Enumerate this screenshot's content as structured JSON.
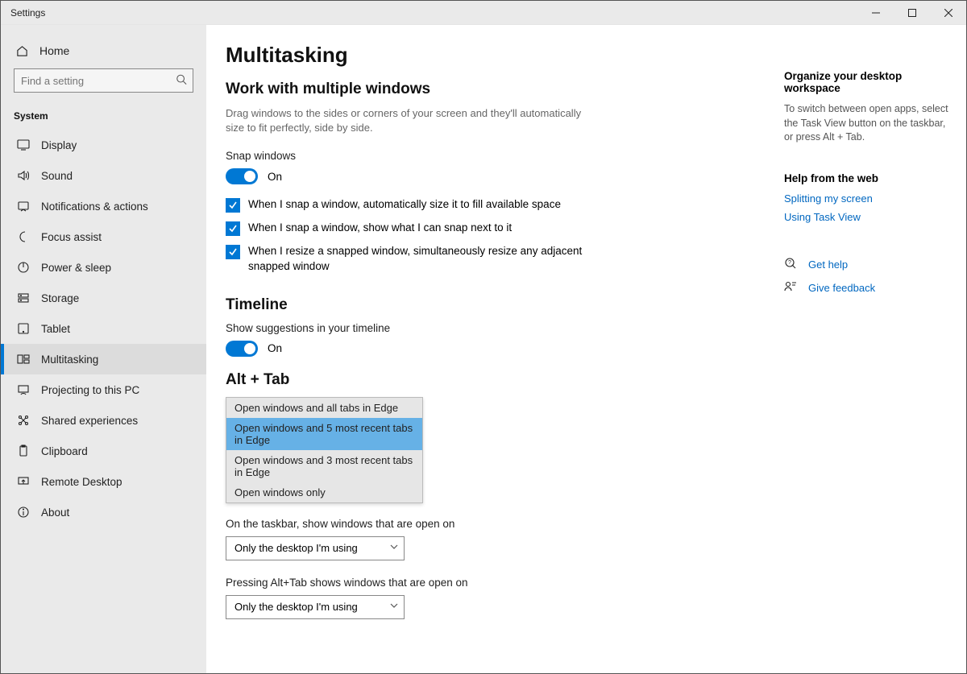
{
  "window": {
    "title": "Settings"
  },
  "sidebar": {
    "home": "Home",
    "search_placeholder": "Find a setting",
    "section": "System",
    "items": [
      {
        "label": "Display"
      },
      {
        "label": "Sound"
      },
      {
        "label": "Notifications & actions"
      },
      {
        "label": "Focus assist"
      },
      {
        "label": "Power & sleep"
      },
      {
        "label": "Storage"
      },
      {
        "label": "Tablet"
      },
      {
        "label": "Multitasking"
      },
      {
        "label": "Projecting to this PC"
      },
      {
        "label": "Shared experiences"
      },
      {
        "label": "Clipboard"
      },
      {
        "label": "Remote Desktop"
      },
      {
        "label": "About"
      }
    ]
  },
  "page": {
    "title": "Multitasking",
    "section1": {
      "heading": "Work with multiple windows",
      "desc": "Drag windows to the sides or corners of your screen and they'll automatically size to fit perfectly, side by side.",
      "snap_label": "Snap windows",
      "snap_state": "On",
      "chk1": "When I snap a window, automatically size it to fill available space",
      "chk2": "When I snap a window, show what I can snap next to it",
      "chk3": "When I resize a snapped window, simultaneously resize any adjacent snapped window"
    },
    "section2": {
      "heading": "Timeline",
      "label": "Show suggestions in your timeline",
      "state": "On"
    },
    "section3": {
      "heading": "Alt + Tab",
      "options": [
        "Open windows and all tabs in Edge",
        "Open windows and 5 most recent tabs in Edge",
        "Open windows and 3 most recent tabs in Edge",
        "Open windows only"
      ]
    },
    "section4": {
      "label1": "On the taskbar, show windows that are open on",
      "value1": "Only the desktop I'm using",
      "label2": "Pressing Alt+Tab shows windows that are open on",
      "value2": "Only the desktop I'm using"
    }
  },
  "right": {
    "heading1": "Organize your desktop workspace",
    "body1": "To switch between open apps, select the Task View button on the taskbar, or press Alt + Tab.",
    "heading2": "Help from the web",
    "link1": "Splitting my screen",
    "link2": "Using Task View",
    "help": "Get help",
    "feedback": "Give feedback"
  }
}
